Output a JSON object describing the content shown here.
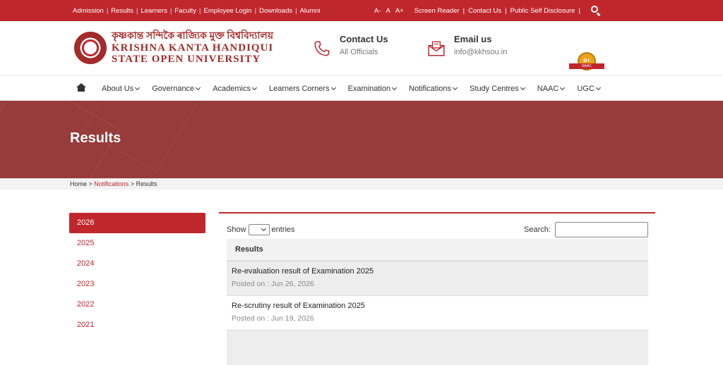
{
  "topbar": {
    "links": [
      "Admission",
      "Results",
      "Learners",
      "Faculty",
      "Employee Login",
      "Downloads",
      "Alumni"
    ],
    "font_sizes": [
      "A-",
      "A",
      "A+"
    ],
    "right_links": [
      "Screen Reader",
      "Contact Us",
      "Public Self Disclosure"
    ]
  },
  "header": {
    "logo_bengali": "কৃষ্ণকান্ত সন্দিকৈ ৰাজ্যিক মুক্ত বিশ্ববিদ্যালয়",
    "logo_line1": "KRISHNA KANTA HANDIQUI",
    "logo_line2": "STATE OPEN UNIVERSITY",
    "contact_title": "Contact Us",
    "contact_sub": "All Officials",
    "email_title": "Email us",
    "email_sub": "info@kkhsou.in",
    "naac_grade": "B+",
    "naac_label": "NAAC"
  },
  "nav": {
    "items": [
      "About Us",
      "Governance",
      "Academics",
      "Learners Corners",
      "Examination",
      "Notifications",
      "Study Centres",
      "NAAC",
      "UGC"
    ]
  },
  "banner": {
    "title": "Results"
  },
  "breadcrumb": {
    "home": "Home",
    "sep": " > ",
    "mid": "Notifications",
    "current": "Results"
  },
  "sidebar": {
    "years": [
      "2026",
      "2025",
      "2024",
      "2023",
      "2022",
      "2021"
    ],
    "active_index": 0
  },
  "table": {
    "show_label": "Show",
    "entries_label": "entries",
    "search_label": "Search:",
    "header": "Results",
    "rows": [
      {
        "title": "Re-evaluation result of Examination 2025",
        "posted": "Posted on : Jun 26, 2026"
      },
      {
        "title": "Re-scrutiny result of Examination 2025",
        "posted": "Posted on : Jun 19, 2026"
      }
    ]
  },
  "colors": {
    "brand_red": "#c0272d",
    "banner": "#983b3b"
  }
}
